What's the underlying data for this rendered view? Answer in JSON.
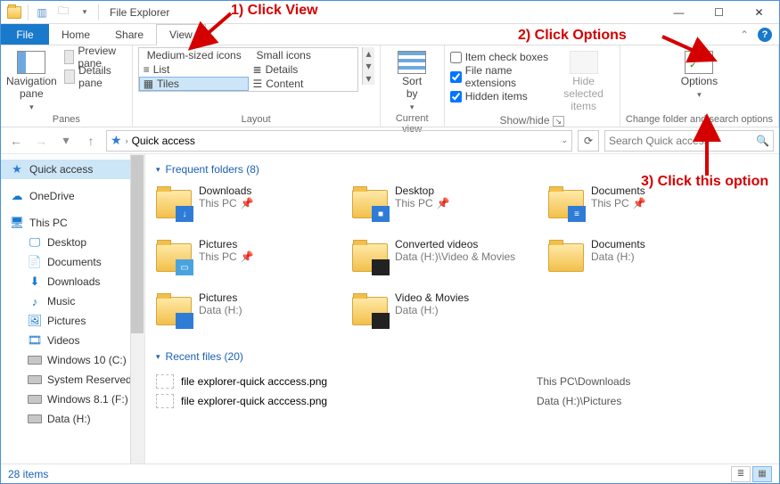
{
  "title": "File Explorer",
  "window_controls": {
    "min": "—",
    "max": "☐",
    "close": "✕"
  },
  "tabs": {
    "file": "File",
    "home": "Home",
    "share": "Share",
    "view": "View"
  },
  "ribbon": {
    "panes": {
      "nav": "Navigation\npane",
      "preview": "Preview pane",
      "details": "Details pane",
      "group": "Panes"
    },
    "layout": {
      "med": "Medium-sized icons",
      "small": "Small icons",
      "list": "List",
      "details": "Details",
      "tiles": "Tiles",
      "content": "Content",
      "group": "Layout"
    },
    "sortby": "Sort\nby",
    "currentview": "Current view",
    "check_item": "Item check boxes",
    "check_ext": "File name extensions",
    "check_hidden": "Hidden items",
    "hide_sel": "Hide selected\nitems",
    "showhide": "Show/hide",
    "options": "Options",
    "change_opts": "Change folder and search options"
  },
  "addr": {
    "path": "Quick access",
    "search_ph": "Search Quick access"
  },
  "tree": {
    "quick": "Quick access",
    "onedrive": "OneDrive",
    "thispc": "This PC",
    "desktop": "Desktop",
    "documents": "Documents",
    "downloads": "Downloads",
    "music": "Music",
    "pictures": "Pictures",
    "videos": "Videos",
    "c": "Windows 10 (C:)",
    "sr": "System Reserved",
    "f": "Windows 8.1 (F:)",
    "h": "Data (H:)"
  },
  "content": {
    "freq_head": "Frequent folders (8)",
    "items": [
      {
        "name": "Downloads",
        "loc": "This PC",
        "badge": "↓",
        "bcolor": "#2e7cd6"
      },
      {
        "name": "Desktop",
        "loc": "This PC",
        "badge": "■",
        "bcolor": "#2e7cd6"
      },
      {
        "name": "Documents",
        "loc": "This PC",
        "badge": "≡",
        "bcolor": "#2e7cd6"
      },
      {
        "name": "Pictures",
        "loc": "This PC",
        "badge": "▭",
        "bcolor": "#4aa3df"
      },
      {
        "name": "Converted videos",
        "loc": "Data (H:)\\Video & Movies",
        "badge": "",
        "bcolor": "#222"
      },
      {
        "name": "Documents",
        "loc": "Data (H:)",
        "badge": "",
        "bcolor": ""
      },
      {
        "name": "Pictures",
        "loc": "Data (H:)",
        "badge": "",
        "bcolor": "#2e7cd6"
      },
      {
        "name": "Video & Movies",
        "loc": "Data (H:)",
        "badge": "",
        "bcolor": "#222"
      }
    ],
    "recent_head": "Recent files (20)",
    "recent": [
      {
        "name": "file explorer-quick acccess.png",
        "loc": "This PC\\Downloads"
      },
      {
        "name": "file explorer-quick acccess.png",
        "loc": "Data (H:)\\Pictures"
      }
    ]
  },
  "status": "28 items",
  "annotations": {
    "a1": "1) Click View",
    "a2": "2) Click Options",
    "a3": "3) Click this option"
  }
}
